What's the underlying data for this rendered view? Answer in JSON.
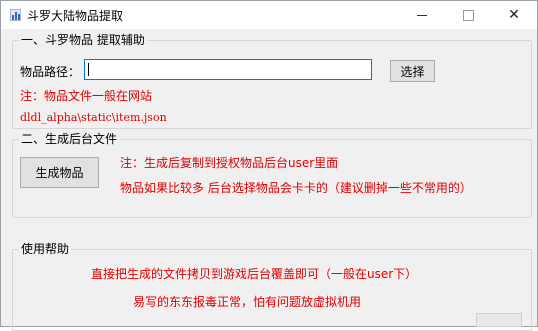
{
  "window": {
    "title": "斗罗大陆物品提取",
    "app_icon": "app-icon",
    "controls": {
      "minimize": "minimize-icon",
      "maximize": "maximize-icon",
      "close": "close-icon",
      "close_glyph": "✕"
    }
  },
  "group1": {
    "legend": "一、斗罗物品 提取辅助",
    "path_label": "物品路径：",
    "path_value": "",
    "browse_label": "选择",
    "note": "注：物品文件一般在网站",
    "path_hint": "dldl_alpha\\static\\item.json"
  },
  "group2": {
    "legend": "二、生成后台文件",
    "generate_label": "生成物品",
    "note_a": "注：生成后复制到授权物品后台user里面",
    "note_b": "物品如果比较多 后台选择物品会卡卡的（建议删掉一些不常用的）"
  },
  "group3": {
    "legend": "使用帮助",
    "help_a": "直接把生成的文件拷贝到游戏后台覆盖即可（一般在user下）",
    "help_b": "易写的东东报毒正常，怕有问题放虚拟机用"
  },
  "colors": {
    "note_red": "#e00000",
    "window_bg": "#f0f0f0",
    "focus_blue": "#0078d7"
  }
}
